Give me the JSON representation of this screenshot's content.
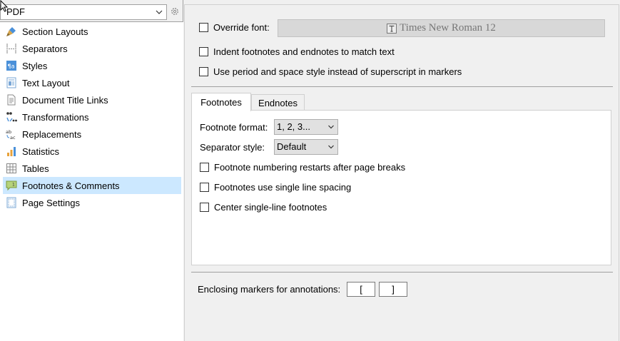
{
  "header": {
    "format_value": "PDF"
  },
  "sidebar": {
    "items": [
      {
        "label": "Section Layouts",
        "icon": "brush-icon"
      },
      {
        "label": "Separators",
        "icon": "separator-icon"
      },
      {
        "label": "Styles",
        "icon": "styles-icon"
      },
      {
        "label": "Text Layout",
        "icon": "text-layout-icon"
      },
      {
        "label": "Document Title Links",
        "icon": "document-icon"
      },
      {
        "label": "Transformations",
        "icon": "transformations-icon"
      },
      {
        "label": "Replacements",
        "icon": "replacements-icon"
      },
      {
        "label": "Statistics",
        "icon": "statistics-icon"
      },
      {
        "label": "Tables",
        "icon": "table-icon"
      },
      {
        "label": "Footnotes & Comments",
        "icon": "footnote-icon",
        "selected": true
      },
      {
        "label": "Page Settings",
        "icon": "page-settings-icon"
      }
    ]
  },
  "options": {
    "override_font_label": "Override font:",
    "override_font_checked": false,
    "font_value": "Times New Roman 12",
    "indent_label": "Indent footnotes and endnotes to match text",
    "indent_checked": false,
    "period_style_label": "Use period and space style instead of superscript in markers",
    "period_style_checked": false
  },
  "tabs": [
    {
      "label": "Footnotes",
      "active": true
    },
    {
      "label": "Endnotes",
      "active": false
    }
  ],
  "footnotes_tab": {
    "format_label": "Footnote format:",
    "format_value": "1, 2, 3...",
    "separator_label": "Separator style:",
    "separator_value": "Default",
    "restart_label": "Footnote numbering restarts after page breaks",
    "restart_checked": false,
    "single_spacing_label": "Footnotes use single line spacing",
    "single_spacing_checked": false,
    "center_label": "Center single-line footnotes",
    "center_checked": false
  },
  "annotations": {
    "label": "Enclosing markers for annotations:",
    "open_marker": "[",
    "close_marker": "]"
  },
  "colors": {
    "selection": "#cce8ff",
    "panel_bg": "#f0f0f0",
    "border": "#a0a0a0"
  }
}
